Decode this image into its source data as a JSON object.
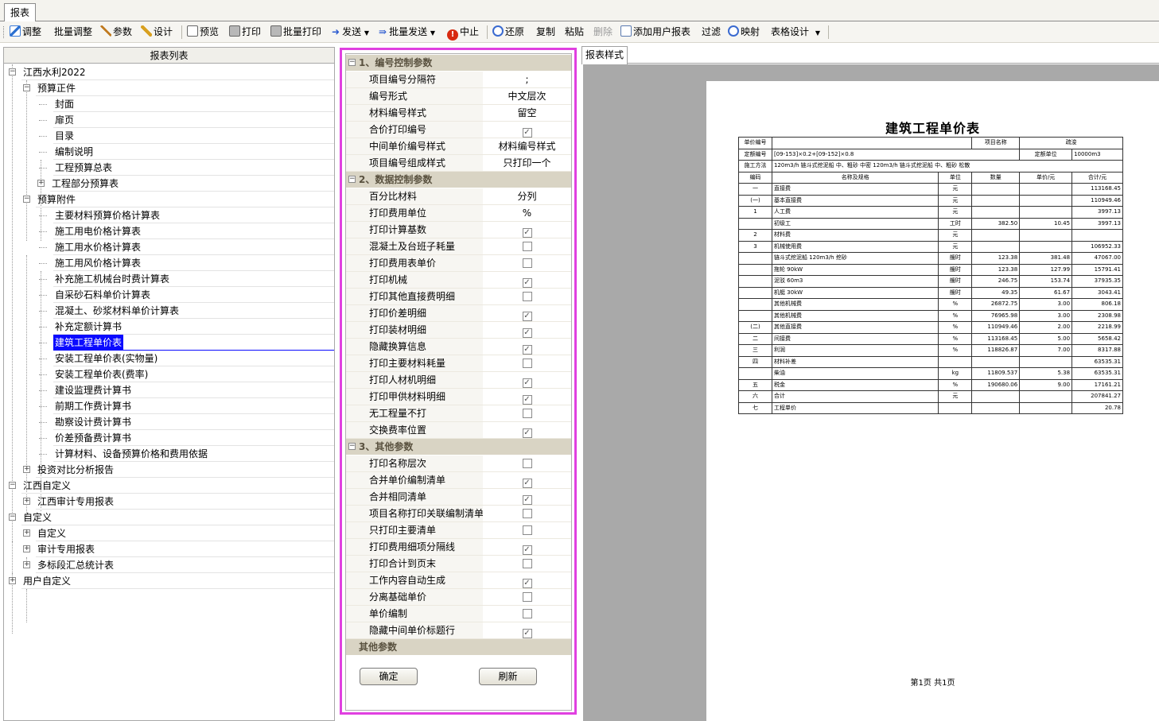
{
  "tab": {
    "label": "报表"
  },
  "toolbar": [
    {
      "label": "调整",
      "icon": "adjust-icon",
      "disabled": false
    },
    {
      "label": "批量调整",
      "icon": "",
      "disabled": false
    },
    {
      "label": "参数",
      "icon": "parameter-icon",
      "disabled": false
    },
    {
      "label": "设计",
      "icon": "design-pen-icon",
      "disabled": false
    },
    {
      "label": "预览",
      "icon": "preview-icon",
      "disabled": false
    },
    {
      "label": "打印",
      "icon": "printer-icon",
      "disabled": false
    },
    {
      "label": "批量打印",
      "icon": "batch-printer-icon",
      "disabled": false
    },
    {
      "label": "发送",
      "icon": "send-arrow-icon",
      "disabled": false
    },
    {
      "label": "批量发送",
      "icon": "batch-send-icon",
      "disabled": false
    },
    {
      "label": "中止",
      "icon": "stop-icon",
      "disabled": false
    },
    {
      "label": "还原",
      "icon": "restore-icon",
      "disabled": false
    },
    {
      "label": "复制",
      "icon": "",
      "disabled": false
    },
    {
      "label": "粘贴",
      "icon": "",
      "disabled": false
    },
    {
      "label": "删除",
      "icon": "",
      "disabled": true
    },
    {
      "label": "添加用户报表",
      "icon": "add-report-icon",
      "disabled": false
    },
    {
      "label": "过滤",
      "icon": "",
      "disabled": false
    },
    {
      "label": "映射",
      "icon": "mapping-icon",
      "disabled": false
    },
    {
      "label": "表格设计",
      "icon": "",
      "disabled": false
    }
  ],
  "report_list": {
    "header": "报表列表",
    "nodes": [
      {
        "label": "江西水利2022",
        "level": 0,
        "expander": "−"
      },
      {
        "label": "预算正件",
        "level": 1,
        "expander": "−"
      },
      {
        "label": "封面",
        "level": 2
      },
      {
        "label": "扉页",
        "level": 2
      },
      {
        "label": "目录",
        "level": 2
      },
      {
        "label": "编制说明",
        "level": 2
      },
      {
        "label": "工程预算总表",
        "level": 2
      },
      {
        "label": "工程部分预算表",
        "level": 1,
        "expander": "+",
        "indent": 2
      },
      {
        "label": "预算附件",
        "level": 1,
        "expander": "−"
      },
      {
        "label": "主要材料预算价格计算表",
        "level": 2
      },
      {
        "label": "施工用电价格计算表",
        "level": 2
      },
      {
        "label": "施工用水价格计算表",
        "level": 2
      },
      {
        "label": "施工用风价格计算表",
        "level": 2
      },
      {
        "label": "补充施工机械台时费计算表",
        "level": 2
      },
      {
        "label": "自采砂石料单价计算表",
        "level": 2
      },
      {
        "label": "混凝土、砂浆材料单价计算表",
        "level": 2
      },
      {
        "label": "补充定额计算书",
        "level": 2
      },
      {
        "label": "建筑工程单价表",
        "level": 2,
        "selected": true
      },
      {
        "label": "安装工程单价表(实物量)",
        "level": 2
      },
      {
        "label": "安装工程单价表(费率)",
        "level": 2
      },
      {
        "label": "建设监理费计算书",
        "level": 2
      },
      {
        "label": "前期工作费计算书",
        "level": 2
      },
      {
        "label": "勘察设计费计算书",
        "level": 2
      },
      {
        "label": "价差预备费计算书",
        "level": 2
      },
      {
        "label": "计算材料、设备预算价格和费用依据",
        "level": 2
      },
      {
        "label": "投资对比分析报告",
        "level": 1,
        "expander": "+"
      },
      {
        "label": "江西自定义",
        "level": 0,
        "expander": "−"
      },
      {
        "label": "江西审计专用报表",
        "level": 1,
        "expander": "+"
      },
      {
        "label": "自定义",
        "level": 0,
        "expander": "−"
      },
      {
        "label": "自定义",
        "level": 1,
        "expander": "+"
      },
      {
        "label": "审计专用报表",
        "level": 1,
        "expander": "+"
      },
      {
        "label": "多标段汇总统计表",
        "level": 1,
        "expander": "+"
      },
      {
        "label": "用户自定义",
        "level": 0,
        "expander": "+"
      }
    ]
  },
  "params": {
    "sections": [
      {
        "title": "1、编号控制参数",
        "rows": [
          {
            "label": "项目编号分隔符",
            "value": ";"
          },
          {
            "label": "编号形式",
            "value": "中文层次"
          },
          {
            "label": "材料编号样式",
            "value": "留空"
          },
          {
            "label": "合价打印编号",
            "checked": true
          },
          {
            "label": "中间单价编号样式",
            "value": "材料编号样式"
          },
          {
            "label": "项目编号组成样式",
            "value": "只打印一个"
          }
        ]
      },
      {
        "title": "2、数据控制参数",
        "rows": [
          {
            "label": "百分比材料",
            "value": "分列"
          },
          {
            "label": "打印费用单位",
            "value": "%"
          },
          {
            "label": "打印计算基数",
            "checked": true
          },
          {
            "label": "混凝土及台班子耗量",
            "checked": false
          },
          {
            "label": "打印费用表单价",
            "checked": false
          },
          {
            "label": "打印机械",
            "checked": true
          },
          {
            "label": "打印其他直接费明细",
            "checked": false
          },
          {
            "label": "打印价差明细",
            "checked": true
          },
          {
            "label": "打印装材明细",
            "checked": true
          },
          {
            "label": "隐藏换算信息",
            "checked": true
          },
          {
            "label": "打印主要材料耗量",
            "checked": false
          },
          {
            "label": "打印人材机明细",
            "checked": true
          },
          {
            "label": "打印甲供材料明细",
            "checked": true
          },
          {
            "label": "无工程量不打",
            "checked": false
          },
          {
            "label": "交换费率位置",
            "checked": true
          }
        ]
      },
      {
        "title": "3、其他参数",
        "rows": [
          {
            "label": "打印名称层次",
            "checked": false
          },
          {
            "label": "合并单价编制清单",
            "checked": true
          },
          {
            "label": "合并相同清单",
            "checked": true
          },
          {
            "label": "项目名称打印关联编制清单",
            "checked": false
          },
          {
            "label": "只打印主要清单",
            "checked": false
          },
          {
            "label": "打印费用细项分隔线",
            "checked": true
          },
          {
            "label": "打印合计到页末",
            "checked": false
          },
          {
            "label": "工作内容自动生成",
            "checked": true
          },
          {
            "label": "分离基础单价",
            "checked": false
          },
          {
            "label": "单价编制",
            "checked": false
          },
          {
            "label": "隐藏中间单价标题行",
            "checked": true
          }
        ]
      }
    ],
    "footer_title": "其他参数",
    "ok_label": "确定",
    "refresh_label": "刷新"
  },
  "preview": {
    "tab_label": "报表样式",
    "title": "建筑工程单价表",
    "header_rows": [
      [
        "单价编号",
        "",
        "项目名称",
        "疏浚"
      ],
      [
        "定额编号",
        "[09-153]×0.2+[09-152]×0.8",
        "定额单位",
        "10000m3"
      ],
      [
        "施工方法",
        "120m3/h 链斗式挖泥船 中、粗砂 中密 120m3/h 链斗式挖泥船 中、粗砂 松散"
      ]
    ],
    "columns": [
      "编码",
      "名称及规格",
      "单位",
      "数量",
      "单价/元",
      "合计/元"
    ],
    "rows": [
      [
        "一",
        "直接费",
        "元",
        "",
        "",
        "113168.45"
      ],
      [
        "(一)",
        "基本直接费",
        "元",
        "",
        "",
        "110949.46"
      ],
      [
        "1",
        "人工费",
        "元",
        "",
        "",
        "3997.13"
      ],
      [
        "",
        "初级工",
        "工时",
        "382.50",
        "10.45",
        "3997.13"
      ],
      [
        "2",
        "材料费",
        "元",
        "",
        "",
        ""
      ],
      [
        "3",
        "机械使用费",
        "元",
        "",
        "",
        "106952.33"
      ],
      [
        "",
        "链斗式挖泥船 120m3/h 挖砂",
        "艘时",
        "123.38",
        "381.48",
        "47067.00"
      ],
      [
        "",
        "拖轮 90kW",
        "艘时",
        "123.38",
        "127.99",
        "15791.41"
      ],
      [
        "",
        "泥驳 60m3",
        "艘时",
        "246.75",
        "153.74",
        "37935.35"
      ],
      [
        "",
        "机艇 30kW",
        "艘时",
        "49.35",
        "61.67",
        "3043.41"
      ],
      [
        "",
        "其他机械费",
        "%",
        "26872.75",
        "3.00",
        "806.18"
      ],
      [
        "",
        "其他机械费",
        "%",
        "76965.98",
        "3.00",
        "2308.98"
      ],
      [
        "(二)",
        "其他直接费",
        "%",
        "110949.46",
        "2.00",
        "2218.99"
      ],
      [
        "二",
        "间接费",
        "%",
        "113168.45",
        "5.00",
        "5658.42"
      ],
      [
        "三",
        "利润",
        "%",
        "118826.87",
        "7.00",
        "8317.88"
      ],
      [
        "四",
        "材料补差",
        "",
        "",
        "",
        "63535.31"
      ],
      [
        "",
        "柴油",
        "kg",
        "11809.537",
        "5.38",
        "63535.31"
      ],
      [
        "五",
        "税金",
        "%",
        "190680.06",
        "9.00",
        "17161.21"
      ],
      [
        "六",
        "合计",
        "元",
        "",
        "",
        "207841.27"
      ],
      [
        "七",
        "工程单价",
        "",
        "",
        "",
        "20.78"
      ]
    ],
    "page_info": "第1页 共1页"
  }
}
